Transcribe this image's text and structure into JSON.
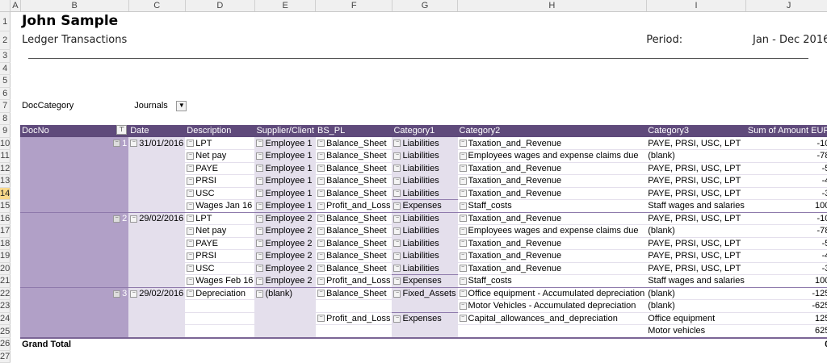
{
  "columns": [
    "",
    "A",
    "B",
    "C",
    "D",
    "E",
    "F",
    "G",
    "H",
    "I",
    "J"
  ],
  "header": {
    "name": "John Sample",
    "subtitle": "Ledger Transactions",
    "period_label": "Period:",
    "period_value": "Jan - Dec 2016"
  },
  "filter": {
    "label": "DocCategory",
    "value": "Journals"
  },
  "pivot": {
    "headers": [
      "DocNo",
      "Date",
      "Description",
      "Supplier/Client",
      "BS_PL",
      "Category1",
      "Category2",
      "Category3",
      "Sum of Amount EUR"
    ],
    "rows": [
      [
        "1",
        "31/01/2016",
        "LPT",
        "Employee 1",
        "Balance_Sheet",
        "Liabilities",
        "Taxation_and_Revenue",
        "PAYE, PRSI, USC, LPT",
        "-10"
      ],
      [
        "",
        "",
        "Net pay",
        "Employee 1",
        "Balance_Sheet",
        "Liabilities",
        "Employees wages and expense claims due",
        "(blank)",
        "-78"
      ],
      [
        "",
        "",
        "PAYE",
        "Employee 1",
        "Balance_Sheet",
        "Liabilities",
        "Taxation_and_Revenue",
        "PAYE, PRSI, USC, LPT",
        "-5"
      ],
      [
        "",
        "",
        "PRSI",
        "Employee 1",
        "Balance_Sheet",
        "Liabilities",
        "Taxation_and_Revenue",
        "PAYE, PRSI, USC, LPT",
        "-4"
      ],
      [
        "",
        "",
        "USC",
        "Employee 1",
        "Balance_Sheet",
        "Liabilities",
        "Taxation_and_Revenue",
        "PAYE, PRSI, USC, LPT",
        "-3"
      ],
      [
        "",
        "",
        "Wages Jan 16",
        "Employee 1",
        "Profit_and_Loss",
        "Expenses",
        "Staff_costs",
        "Staff wages and salaries",
        "100"
      ],
      [
        "2",
        "29/02/2016",
        "LPT",
        "Employee 2",
        "Balance_Sheet",
        "Liabilities",
        "Taxation_and_Revenue",
        "PAYE, PRSI, USC, LPT",
        "-10"
      ],
      [
        "",
        "",
        "Net pay",
        "Employee 2",
        "Balance_Sheet",
        "Liabilities",
        "Employees wages and expense claims due",
        "(blank)",
        "-78"
      ],
      [
        "",
        "",
        "PAYE",
        "Employee 2",
        "Balance_Sheet",
        "Liabilities",
        "Taxation_and_Revenue",
        "PAYE, PRSI, USC, LPT",
        "-5"
      ],
      [
        "",
        "",
        "PRSI",
        "Employee 2",
        "Balance_Sheet",
        "Liabilities",
        "Taxation_and_Revenue",
        "PAYE, PRSI, USC, LPT",
        "-4"
      ],
      [
        "",
        "",
        "USC",
        "Employee 2",
        "Balance_Sheet",
        "Liabilities",
        "Taxation_and_Revenue",
        "PAYE, PRSI, USC, LPT",
        "-3"
      ],
      [
        "",
        "",
        "Wages Feb 16",
        "Employee 2",
        "Profit_and_Loss",
        "Expenses",
        "Staff_costs",
        "Staff wages and salaries",
        "100"
      ],
      [
        "3",
        "29/02/2016",
        "Depreciation",
        "(blank)",
        "Balance_Sheet",
        "Fixed_Assets",
        "Office equipment - Accumulated depreciation",
        "(blank)",
        "-125"
      ],
      [
        "",
        "",
        "",
        "",
        "",
        "",
        "Motor Vehicles - Accumulated depreciation",
        "(blank)",
        "-625"
      ],
      [
        "",
        "",
        "",
        "",
        "Profit_and_Loss",
        "Expenses",
        "Capital_allowances_and_depreciation",
        "Office equipment",
        "125"
      ],
      [
        "",
        "",
        "",
        "",
        "",
        "",
        "",
        "Motor vehicles",
        "625"
      ]
    ],
    "grand_total_label": "Grand Total",
    "grand_total_value": "0"
  },
  "selected_row": "14"
}
